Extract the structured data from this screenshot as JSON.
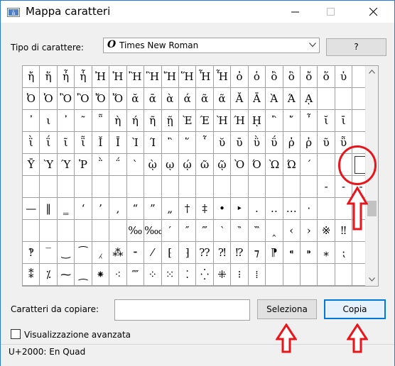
{
  "window": {
    "title": "Mappa caratteri",
    "controls": [
      "minimize",
      "maximize",
      "close"
    ]
  },
  "font_row": {
    "label": "Tipo di carattere:",
    "font_glyph": "O",
    "selected_font": "Times New Roman",
    "help_button": "?"
  },
  "grid": {
    "rows": [
      [
        "ἤ",
        "ἥ",
        "ἦ",
        "ἧ",
        "Ἠ",
        "Ἡ",
        "Ἢ",
        "Ἣ",
        "Ἤ",
        "Ἥ",
        "Ἦ",
        "Ἧ",
        "ὀ",
        "ὁ",
        "ὂ",
        "ὃ",
        "ὄ",
        "ὅ",
        "ὐ",
        ""
      ],
      [
        "Ὀ",
        "Ὁ",
        "Ὂ",
        "Ὃ",
        "Ὄ",
        "Ὅ",
        "ᾰ",
        "ᾱ",
        "ὰ",
        "ά",
        "ᾶ",
        "ᾶ",
        "Ᾰ",
        "Ᾱ",
        "Ὰ",
        "Ά",
        "ᾼ",
        "",
        "",
        ""
      ],
      [
        "᾽",
        "ι",
        "᾿",
        "῀",
        "῁",
        "ὴ",
        "ή",
        "ῆ",
        "ῇ",
        "Ὲ",
        "Έ",
        "Ὴ",
        "Ή",
        "ῌ",
        "῍",
        "῎",
        "῏",
        "ῐ",
        "ῑ",
        ""
      ],
      [
        "ῒ",
        "ΐ",
        "ῖ",
        "ῗ",
        "Ῐ",
        "Ῑ",
        "Ὶ",
        "Ί",
        "῝",
        "῞",
        "῟",
        "ῠ",
        "ῡ",
        "ῢ",
        "ΰ",
        "ῤ",
        "ῥ",
        "ῦ",
        "ῧ",
        ""
      ],
      [
        "Ῡ",
        "Ὺ",
        "Ύ",
        "Ῥ",
        "῭",
        "΅",
        "`",
        "ῲ",
        "ῳ",
        "ῴ",
        "ῶ",
        "ῷ",
        "Ὸ",
        "Ό",
        "Ὼ",
        "Ώ",
        "´",
        "",
        "",
        ""
      ],
      [
        "",
        "",
        "",
        "",
        "",
        "",
        "",
        "",
        "",
        "",
        "",
        "",
        "",
        "",
        "",
        "",
        "",
        "-",
        "-",
        "-"
      ],
      [
        "—",
        "‖",
        "‗",
        "‘",
        "’",
        "‚",
        "“",
        "”",
        "„",
        "†",
        "‡",
        "•",
        "‣",
        "․",
        "‥",
        "…",
        "‧",
        "",
        "",
        ""
      ],
      [
        "",
        "",
        "",
        "",
        "",
        "",
        "‰",
        "‱",
        "′",
        "″",
        "‴",
        "‵",
        "‶",
        "‷",
        "‸",
        "‹",
        "›",
        "※",
        "‼",
        ""
      ],
      [
        "‽",
        "‾",
        "‿",
        "⁀",
        "⁁",
        "⁂",
        "⁃",
        "⁄",
        "⁅",
        "⁆",
        "⁇",
        "⁈",
        "⁉",
        "⁊",
        "⁋",
        "⁌",
        "⁍",
        "⁎",
        "⁏",
        ""
      ],
      [
        "⁑",
        "⁒",
        "⁓",
        "⁔",
        "⁕",
        "⁖",
        "⁗",
        "⁘",
        "⁙",
        "⁚",
        "⁛",
        "⁜",
        "⁝",
        "⁞",
        "",
        "",
        "",
        "",
        "",
        ""
      ]
    ]
  },
  "copy_row": {
    "label": "Caratteri da copiare:",
    "value": "",
    "select_button": "Seleziona",
    "copy_button": "Copia"
  },
  "advanced": {
    "label": "Visualizzazione avanzata",
    "checked": false
  },
  "status": {
    "text": "U+2000: En Quad"
  },
  "colors": {
    "annotation": "#e8151b",
    "window_border": "#2b78d6"
  }
}
